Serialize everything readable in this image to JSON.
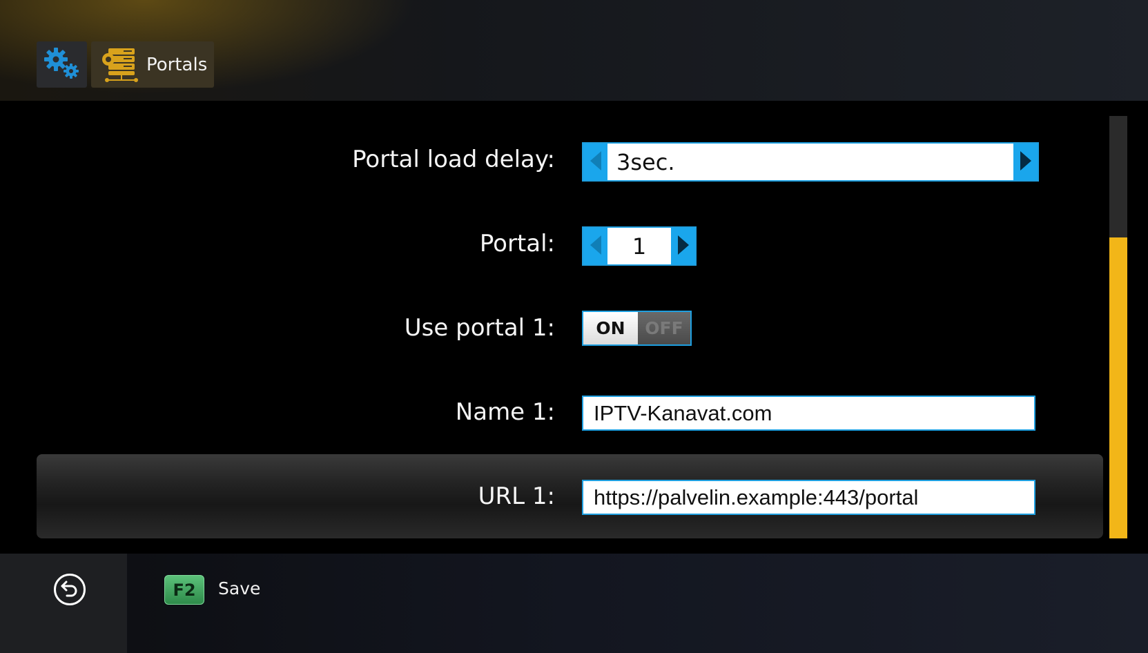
{
  "header": {
    "breadcrumb_settings_icon": "gears-icon",
    "breadcrumb_portals_icon": "server-rack-icon",
    "breadcrumb_title": "Portals"
  },
  "form": {
    "load_delay": {
      "label": "Portal load delay:",
      "value": "3sec."
    },
    "portal": {
      "label": "Portal:",
      "value": "1"
    },
    "use_portal": {
      "label": "Use portal 1:",
      "on": "ON",
      "off": "OFF",
      "state": "ON"
    },
    "name": {
      "label": "Name 1:",
      "value": "IPTV-Kanavat.com"
    },
    "url": {
      "label": "URL 1:",
      "value": "https://palvelin.example:443/portal"
    }
  },
  "footer": {
    "back_icon": "back-arrow-icon",
    "save_key": "F2",
    "save_label": "Save"
  },
  "colors": {
    "accent_blue": "#1aa6ec",
    "scroll_thumb": "#f2b618",
    "key_green": "#3fa35e"
  }
}
